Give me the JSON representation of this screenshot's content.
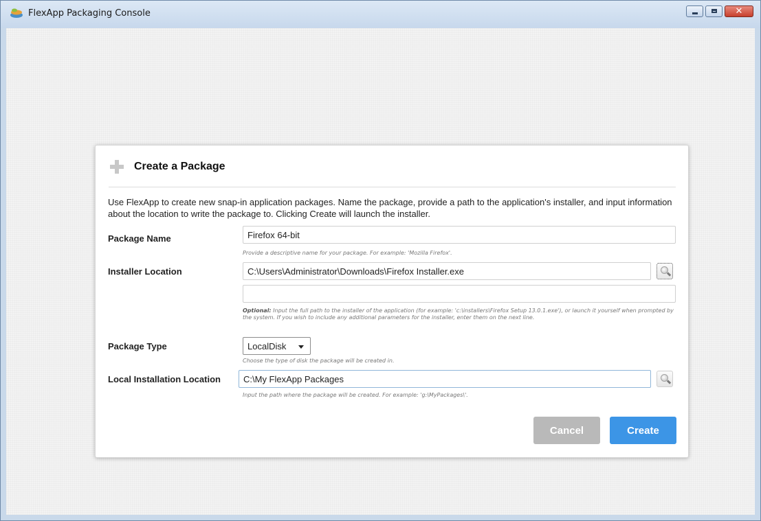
{
  "window": {
    "title": "FlexApp Packaging Console",
    "buttons": {
      "minimize": "minimize",
      "maximize": "maximize",
      "close": "✕"
    }
  },
  "card": {
    "title": "Create a Package",
    "intro": "Use FlexApp to create new snap-in application packages. Name the package, provide a path to the application's installer, and input information about the location to write the package to. Clicking Create will launch the installer.",
    "package_name": {
      "label": "Package Name",
      "value": "Firefox 64-bit",
      "hint": "Provide a descriptive name for your package. For example: 'Mozilla Firefox'."
    },
    "installer_location": {
      "label": "Installer Location",
      "value": "C:\\Users\\Administrator\\Downloads\\Firefox Installer.exe",
      "params_value": "",
      "hint_prefix": "Optional:",
      "hint": " Input the full path to the installer of the application (for example: 'c:\\installers\\Firefox Setup 13.0.1.exe'), or launch it yourself when prompted by the system. If you wish to include any additional parameters for the installer, enter them on the next line."
    },
    "package_type": {
      "label": "Package Type",
      "value": "LocalDisk",
      "hint": "Choose the type of disk the package will be created in."
    },
    "local_location": {
      "label": "Local Installation Location",
      "value": "C:\\My FlexApp Packages",
      "hint": "Input the path where the package will be created. For example: 'g:\\MyPackages\\'."
    },
    "cancel_label": "Cancel",
    "create_label": "Create"
  },
  "colors": {
    "create_button": "#3c95e6",
    "cancel_button": "#b9b9b9"
  }
}
